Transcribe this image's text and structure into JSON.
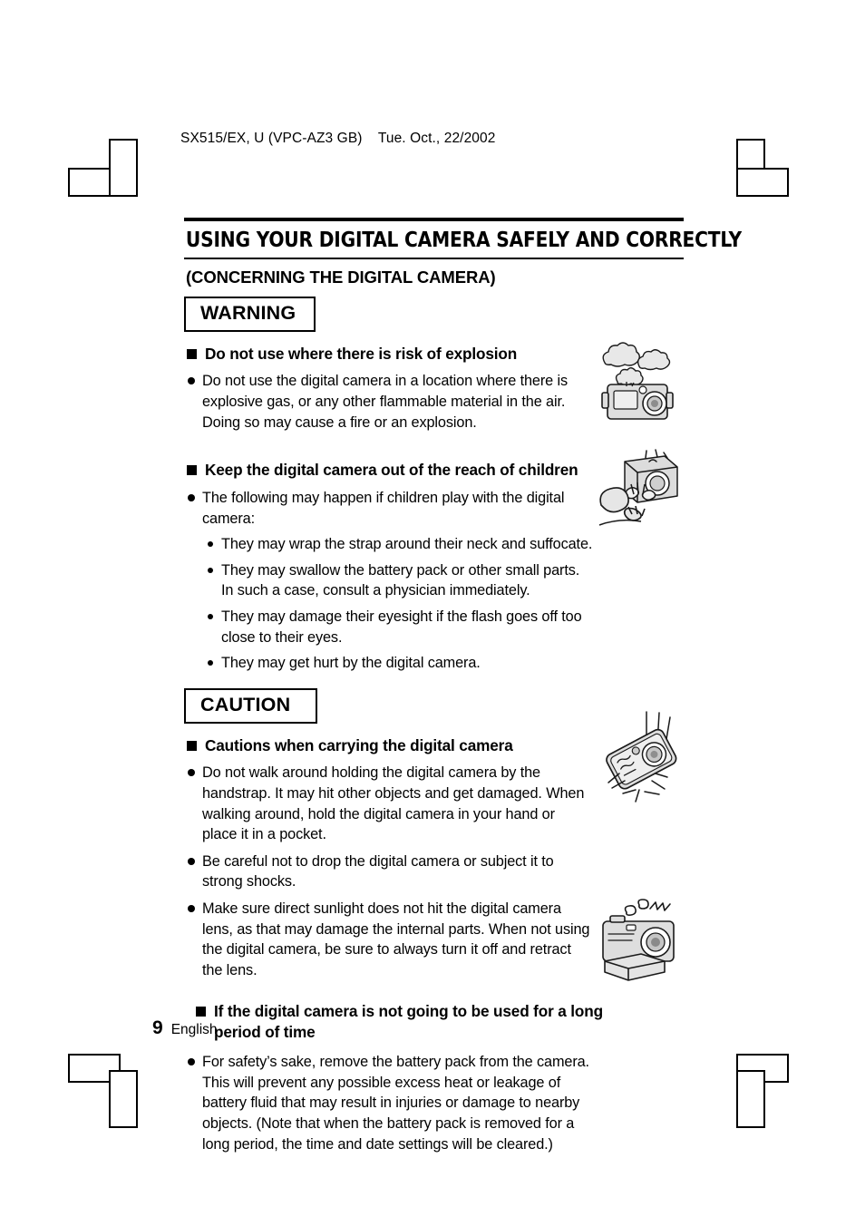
{
  "running_header": "SX515/EX, U (VPC-AZ3 GB)    Tue. Oct., 22/2002",
  "doc": {
    "title": "USING YOUR DIGITAL CAMERA SAFELY AND CORRECTLY",
    "subtitle": "(CONCERNING THE DIGITAL CAMERA)"
  },
  "warning": {
    "label": "WARNING",
    "sections": [
      {
        "heading": "Do not use where there is risk of explosion",
        "bullets": [
          "Do not use the digital camera in a location where there is explosive gas, or any other flammable material in the air. Doing so may cause a fire or an explosion."
        ],
        "figure": "camera-explosion-illustration"
      },
      {
        "heading": "Keep the digital camera out of the reach of children",
        "bullets": [
          "The following may happen if children play with the digital camera:"
        ],
        "sub_bullets": [
          "They may wrap the strap around their neck and suffocate.",
          "They may swallow the battery pack or other small parts. In such a case, consult a physician immediately.",
          "They may damage their eyesight if the flash goes off too close to their eyes.",
          "They may get hurt by the digital camera."
        ],
        "figure": "child-reaching-camera-illustration"
      }
    ]
  },
  "caution": {
    "label": "CAUTION",
    "sections": [
      {
        "heading": "Cautions when carrying the digital camera",
        "bullets": [
          "Do not walk around holding the digital camera by the handstrap. It may hit other objects and get damaged. When walking around, hold the digital camera in your hand or place it in a pocket.",
          "Be careful not to drop the digital camera or subject it to strong shocks.",
          "Make sure direct sunlight does not hit the digital camera lens, as that may damage the internal parts. When not using the digital camera, be sure to always turn it off and retract the lens."
        ],
        "figure": "camera-dropping-illustration"
      },
      {
        "heading": "If the digital camera is not going to be used for a long period of time",
        "bullets": [
          "For safety’s sake, remove the battery pack from the camera. This will prevent any possible excess heat or leakage of battery fluid that may result in injuries or damage to nearby objects. (Note that when the battery pack is removed for a long period, the time and date settings will be cleared.)"
        ],
        "figure": "camera-battery-removed-illustration"
      }
    ]
  },
  "footer": {
    "page_number": "9",
    "language": "English"
  },
  "colors": {
    "ink": "#000000",
    "paper": "#ffffff",
    "illustration_fill": "#e2e2e2",
    "illustration_shade": "#bdbdbd"
  }
}
